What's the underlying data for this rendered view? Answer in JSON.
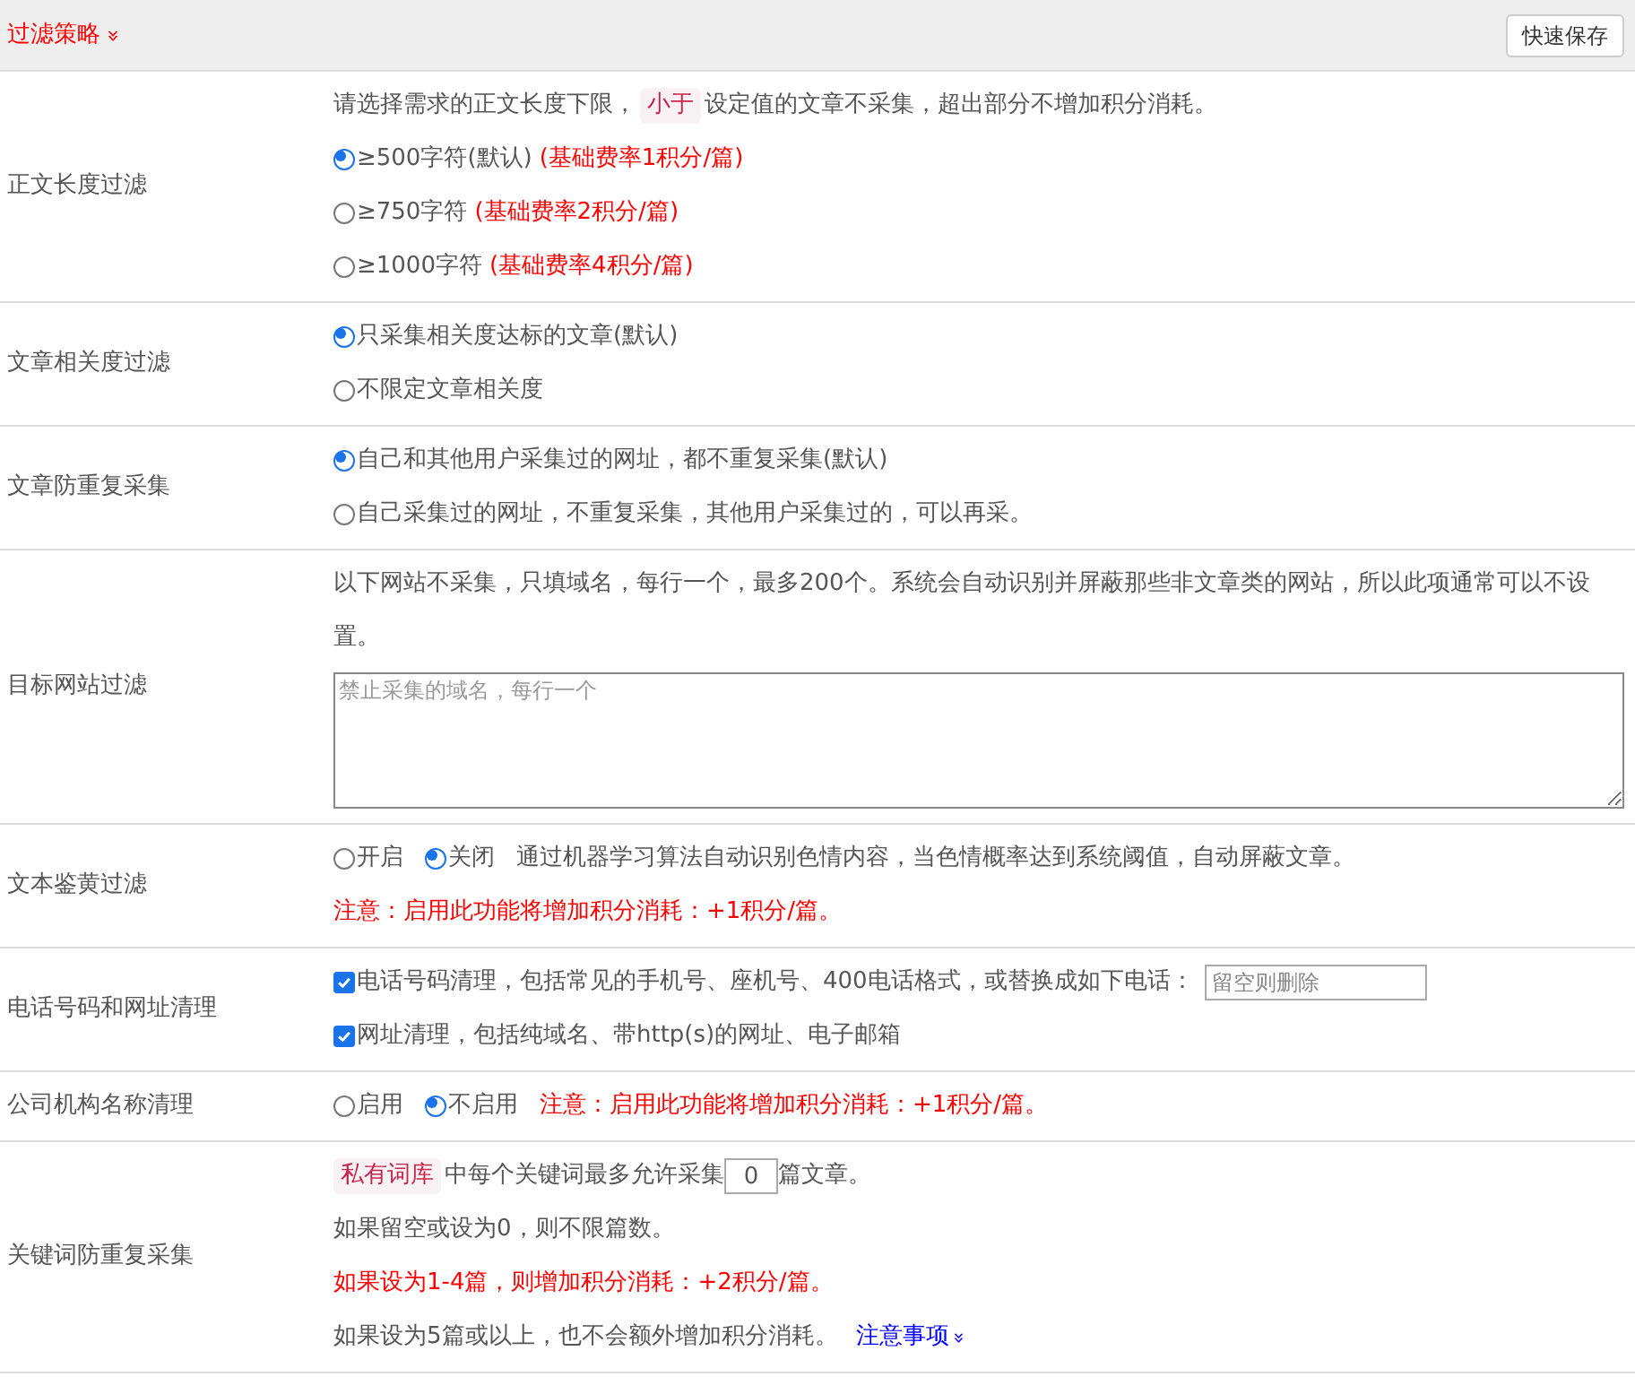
{
  "header": {
    "title": "过滤策略",
    "expand_icon": "»",
    "save_button": "快速保存"
  },
  "rows": [
    {
      "label": "正文长度过滤",
      "items": [
        {
          "kind": "note",
          "parts": [
            {
              "text": "请选择需求的正文长度下限，"
            },
            {
              "text": "小于",
              "tag": true
            },
            {
              "text": "设定值的文章不采集，超出部分不增加积分消耗。"
            }
          ]
        },
        {
          "kind": "radio",
          "selected": true,
          "text": "≥500字符(默认)",
          "extra": "(基础费率1积分/篇)"
        },
        {
          "kind": "radio",
          "selected": false,
          "text": "≥750字符",
          "extra": "(基础费率2积分/篇)"
        },
        {
          "kind": "radio",
          "selected": false,
          "text": "≥1000字符",
          "extra": "(基础费率4积分/篇)"
        }
      ]
    },
    {
      "label": "文章相关度过滤",
      "items": [
        {
          "kind": "radio",
          "selected": true,
          "text": "只采集相关度达标的文章(默认)"
        },
        {
          "kind": "radio",
          "selected": false,
          "text": "不限定文章相关度"
        }
      ]
    },
    {
      "label": "文章防重复采集",
      "items": [
        {
          "kind": "radio",
          "selected": true,
          "text": "自己和其他用户采集过的网址，都不重复采集(默认)"
        },
        {
          "kind": "radio",
          "selected": false,
          "text": "自己采集过的网址，不重复采集，其他用户采集过的，可以再采。"
        }
      ]
    },
    {
      "label": "目标网站过滤",
      "items": [
        {
          "kind": "note",
          "parts": [
            {
              "text": "以下网站不采集，只填域名，每行一个，最多200个。系统会自动识别并屏蔽那些非文章类的网站，所以此项通常可以不设置。"
            }
          ]
        },
        {
          "kind": "textarea",
          "placeholder": "禁止采集的域名，每行一个"
        }
      ]
    },
    {
      "label": "文本鉴黄过滤",
      "items": [
        {
          "kind": "radios",
          "options": [
            {
              "text": "开启",
              "selected": false
            },
            {
              "text": "关闭",
              "selected": true
            }
          ],
          "extra": "通过机器学习算法自动识别色情内容，当色情概率达到系统阈值，自动屏蔽文章。",
          "extra_red": false
        },
        {
          "kind": "warning",
          "text": "注意：启用此功能将增加积分消耗：+1积分/篇。"
        }
      ]
    },
    {
      "label": "电话号码和网址清理",
      "items": [
        {
          "kind": "checkbox",
          "checked": true,
          "text": "电话号码清理，包括常见的手机号、座机号、400电话格式，或替换成如下电话：",
          "placeholder": "留空则删除"
        },
        {
          "kind": "checkbox",
          "checked": true,
          "text": "网址清理，包括纯域名、带http(s)的网址、电子邮箱"
        }
      ]
    },
    {
      "label": "公司机构名称清理",
      "items": [
        {
          "kind": "radios",
          "options": [
            {
              "text": "启用",
              "selected": false
            },
            {
              "text": "不启用",
              "selected": true
            }
          ],
          "extra": "注意：启用此功能将增加积分消耗：+1积分/篇。",
          "extra_red": true
        }
      ]
    },
    {
      "label": "关键词防重复采集",
      "items": [
        {
          "kind": "limit",
          "tag": "私有词库",
          "before": "中每个关键词最多允许采集",
          "value": "0",
          "after": "篇文章。"
        },
        {
          "kind": "note",
          "parts": [
            {
              "text": "如果留空或设为0，则不限篇数。"
            }
          ]
        },
        {
          "kind": "warning",
          "text": "如果设为1-4篇，则增加积分消耗：+2积分/篇。"
        },
        {
          "kind": "note",
          "parts": [
            {
              "text": "如果设为5篇或以上，也不会额外增加积分消耗。"
            }
          ],
          "link": "注意事项",
          "link_icon": "»"
        }
      ]
    }
  ]
}
